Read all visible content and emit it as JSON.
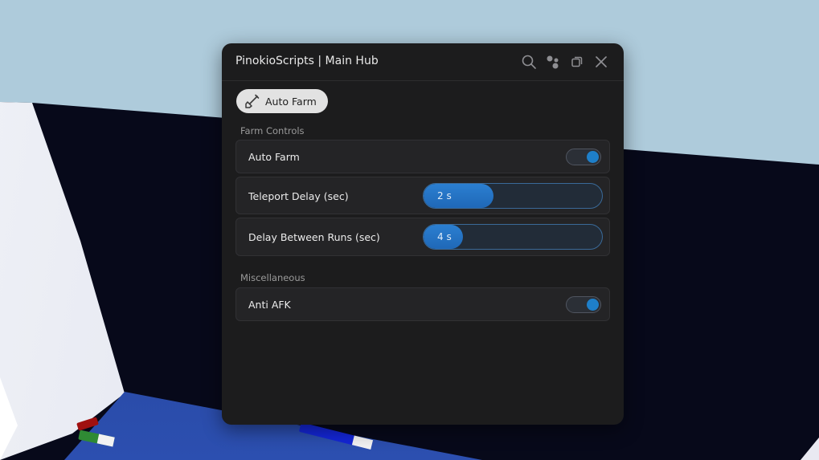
{
  "window": {
    "title": "PinokioScripts | Main Hub"
  },
  "tabs": [
    {
      "label": "Auto Farm",
      "icon": "shovel-icon"
    }
  ],
  "sections": {
    "farm": {
      "label": "Farm Controls",
      "auto_farm": {
        "label": "Auto Farm",
        "enabled": true
      },
      "teleport_delay": {
        "label": "Teleport Delay (sec)",
        "value_text": "2 s",
        "fill_fraction": 0.39
      },
      "delay_between_runs": {
        "label": "Delay Between Runs (sec)",
        "value_text": "4 s",
        "fill_fraction": 0.22
      }
    },
    "misc": {
      "label": "Miscellaneous",
      "anti_afk": {
        "label": "Anti AFK",
        "enabled": true
      }
    }
  },
  "colors": {
    "accent": "#1e7fc9",
    "window_bg": "#1c1c1d",
    "row_bg": "#242426"
  },
  "icons": [
    "search-icon",
    "theme-icon",
    "minimize-icon",
    "close-icon",
    "shovel-icon"
  ]
}
